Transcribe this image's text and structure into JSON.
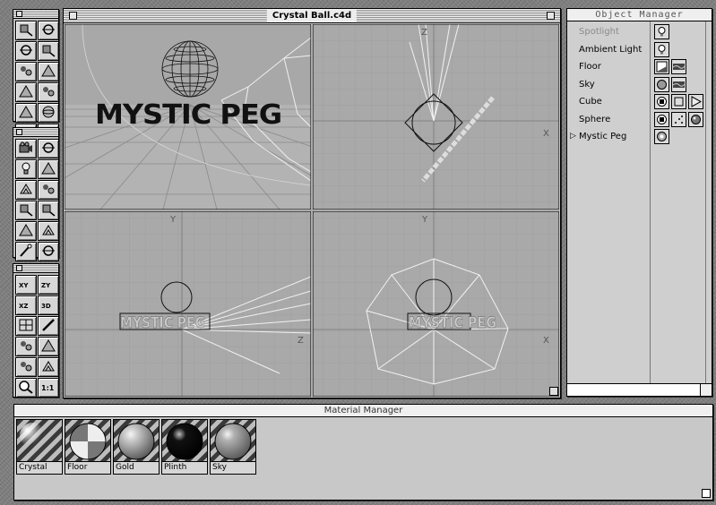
{
  "window": {
    "title": "Crystal Ball.c4d"
  },
  "viewports": {
    "perspective": {
      "logo_text": "MYSTIC PEG"
    },
    "top": {
      "x_axis_label": "X",
      "z_axis_label": "Z"
    },
    "right": {
      "y_axis_label": "Y",
      "z_axis_label": "Z",
      "logo_text": "MYSTIC PEG"
    },
    "front": {
      "y_axis_label": "Y",
      "x_axis_label": "X",
      "logo_text": "MYSTIC PEG"
    }
  },
  "tool_palettes": [
    {
      "tools": [
        "move-camera-icon",
        "rotate-camera-icon",
        "zoom-camera-icon",
        "rotate-icon",
        "x-axis-lock-icon",
        "z-axis-lock-icon",
        "y-axis-lock-icon",
        "world-coords-icon",
        "anchor-icon",
        "sphere-tool-icon",
        "scale-icon",
        "model-tool-icon"
      ]
    },
    {
      "tools": [
        "camera-icon",
        "render-icon",
        "light-icon",
        "axis-icon",
        "object-mode-icon",
        "texture-mode-icon",
        "edit-points-icon",
        "edit-polygons-icon",
        "bone-icon",
        "skeleton-icon",
        "magic-wand-icon",
        "hierarchy-icon"
      ]
    },
    {
      "tools": [
        "view-xy-icon",
        "view-zy-icon",
        "view-xz-icon",
        "view-3d-icon",
        "four-views-icon",
        "pencil-icon",
        "render-region-icon",
        "render-all-icon",
        "save-icon",
        "render-view-icon",
        "magnifier-icon",
        "one-to-one-icon"
      ]
    }
  ],
  "view_labels": {
    "xy": "XY",
    "zy": "ZY",
    "xz": "XZ",
    "3d": "3D",
    "one_to_one": "1:1"
  },
  "object_manager": {
    "title": "Object Manager",
    "objects": [
      {
        "name": "Spotlight",
        "dim": true,
        "expandable": false,
        "tags": [
          "light-icon"
        ]
      },
      {
        "name": "Ambient Light",
        "dim": false,
        "expandable": false,
        "tags": [
          "light-icon"
        ]
      },
      {
        "name": "Floor",
        "dim": false,
        "expandable": false,
        "tags": [
          "floor-icon",
          "texture-tag-icon"
        ]
      },
      {
        "name": "Sky",
        "dim": false,
        "expandable": false,
        "tags": [
          "sky-icon",
          "texture-tag-icon"
        ]
      },
      {
        "name": "Cube",
        "dim": false,
        "expandable": false,
        "tags": [
          "primitive-icon",
          "cube-icon",
          "play-icon"
        ]
      },
      {
        "name": "Sphere",
        "dim": false,
        "expandable": false,
        "tags": [
          "primitive-icon",
          "points-icon",
          "sphere-tag-icon"
        ]
      },
      {
        "name": "Mystic Peg",
        "dim": false,
        "expandable": true,
        "tags": [
          "object-icon"
        ]
      }
    ]
  },
  "material_manager": {
    "title": "Material Manager",
    "materials": [
      {
        "name": "Crystal",
        "style": "crystal",
        "color": "#ffffff"
      },
      {
        "name": "Floor",
        "style": "checker",
        "color": "#cfcfcf"
      },
      {
        "name": "Gold",
        "style": "matte",
        "color": "#c9c9c9"
      },
      {
        "name": "Plinth",
        "style": "dark",
        "color": "#111111"
      },
      {
        "name": "Sky",
        "style": "matte",
        "color": "#b0b0b0"
      }
    ]
  }
}
